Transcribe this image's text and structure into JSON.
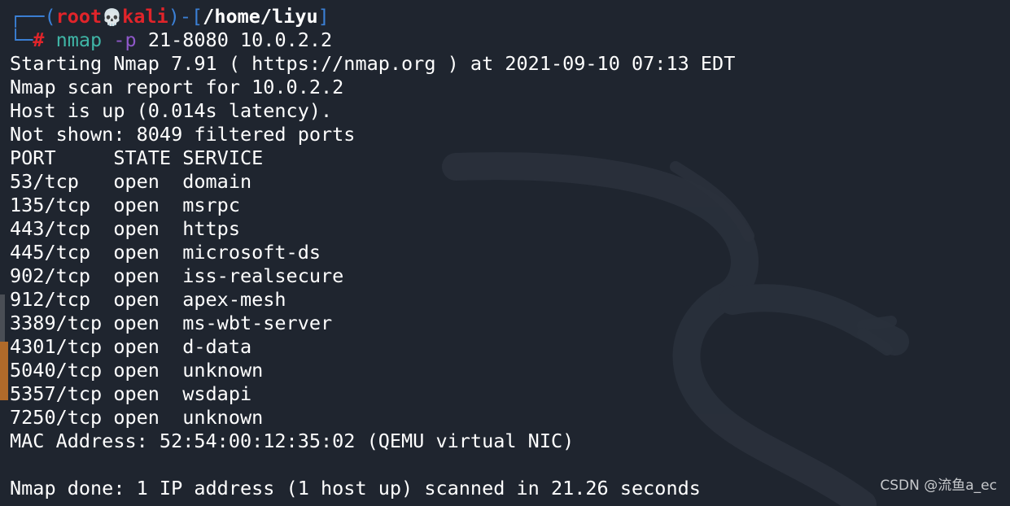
{
  "prompt": {
    "corner_top": "┌──",
    "open_paren": "(",
    "user": "root",
    "skull_glyph": "💀",
    "host": "kali",
    "close_paren": ")",
    "dash": "-",
    "open_bracket": "[",
    "path": "/home/liyu",
    "close_bracket": "]",
    "corner_bottom": "└─",
    "hash": "#",
    "command": "nmap",
    "flag": "-p",
    "args": "21-8080 10.0.2.2"
  },
  "output": {
    "starting": "Starting Nmap 7.91 ( https://nmap.org ) at 2021-09-10 07:13 EDT",
    "report": "Nmap scan report for 10.0.2.2",
    "host_up": "Host is up (0.014s latency).",
    "not_shown": "Not shown: 8049 filtered ports",
    "header": "PORT     STATE SERVICE",
    "ports": [
      "53/tcp   open  domain",
      "135/tcp  open  msrpc",
      "443/tcp  open  https",
      "445/tcp  open  microsoft-ds",
      "902/tcp  open  iss-realsecure",
      "912/tcp  open  apex-mesh",
      "3389/tcp open  ms-wbt-server",
      "4301/tcp open  d-data",
      "5040/tcp open  unknown",
      "5357/tcp open  wsdapi",
      "7250/tcp open  unknown"
    ],
    "mac": "MAC Address: 52:54:00:12:35:02 (QEMU virtual NIC)",
    "blank": "",
    "done": "Nmap done: 1 IP address (1 host up) scanned in 21.26 seconds"
  },
  "watermark": "CSDN @流鱼a_ec",
  "colors": {
    "background": "#1f252f",
    "prompt_frame": "#3b80d6",
    "user_host": "#e0242a",
    "command": "#3fb5a6",
    "flag": "#8f58c9"
  }
}
